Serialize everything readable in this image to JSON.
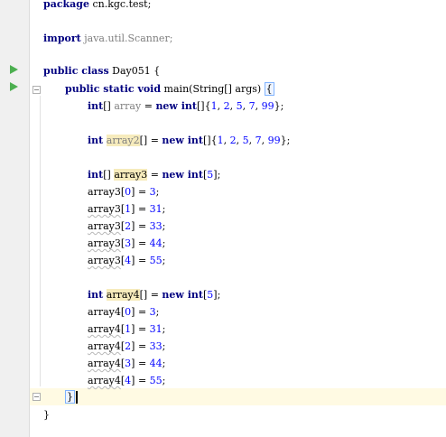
{
  "editor": {
    "colors": {
      "keyword": "#000080",
      "number": "#0000ff",
      "unused": "#808080",
      "highlight": "#f6ebbc",
      "caret_line": "#fffae3",
      "run": "#4caf50"
    },
    "lines": {
      "package_kw": "package",
      "package_name": " cn.kgc.test;",
      "import_kw": "import",
      "import_name": " java.util.Scanner;",
      "class_public": "public",
      "class_kw": " class",
      "class_name": " Day051 {",
      "main_mods": "public static void",
      "main_sig": " main(String[] args) ",
      "main_brace": "{",
      "l1_type": "int",
      "l1_rest_a": "[] ",
      "l1_var": "array",
      "l1_rest_b": " = ",
      "l1_new": "new",
      "l1_type2": " int",
      "l1_init_a": "[]{",
      "l1_n1": "1",
      "l1_n2": "2",
      "l1_n3": "5",
      "l1_n4": "7",
      "l1_n5": "99",
      "l1_end": "};",
      "l2_type": "int",
      "l2_var": "array2",
      "l2_rest": "[] = ",
      "l2_new": "new",
      "l2_type2": " int",
      "l2_init_a": "[]{",
      "l2_n1": "1",
      "l2_n2": "2",
      "l2_n3": "5",
      "l2_n4": "7",
      "l2_n5": "99",
      "l2_end": "};",
      "l3_type": "int",
      "l3_rest": "[] ",
      "l3_var": "array3",
      "l3_eq": " = ",
      "l3_new": "new",
      "l3_type2": " int",
      "l3_size": "5",
      "l4_name": "array3",
      "l4_idx": [
        "0",
        "1",
        "2",
        "3",
        "4"
      ],
      "l4_val": [
        "3",
        "31",
        "33",
        "44",
        "55"
      ],
      "l5_type": "int",
      "l5_var": "array4",
      "l5_rest": "[] = ",
      "l5_new": "new",
      "l5_type2": " int",
      "l5_size": "5",
      "l6_name": "array4",
      "l6_idx": [
        "0",
        "1",
        "2",
        "3",
        "4"
      ],
      "l6_val": [
        "3",
        "31",
        "33",
        "44",
        "55"
      ],
      "close_method": "}",
      "close_class": "}"
    }
  }
}
